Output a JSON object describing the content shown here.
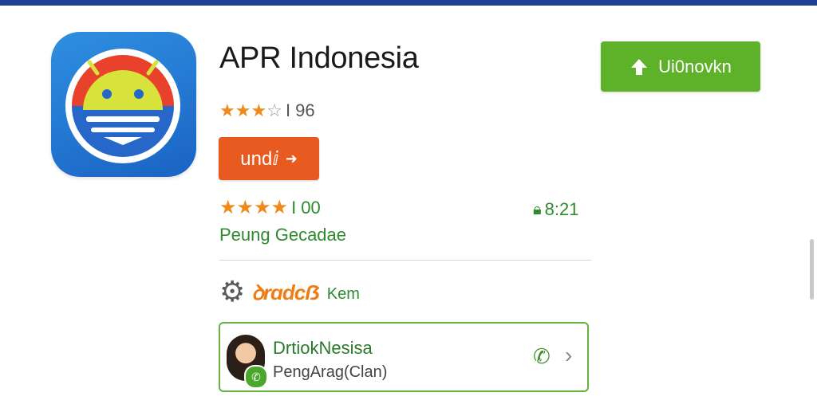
{
  "app": {
    "title": "APR Indonesia",
    "icon": "android-robot-icon"
  },
  "rating_primary": {
    "stars_filled": 3,
    "stars_total": 4,
    "text": "I 96"
  },
  "install_button": {
    "label": "undⅈ",
    "icon": "arrow-right-icon"
  },
  "download_button": {
    "label": "Ui0novkn",
    "icon": "upload-arrow-icon"
  },
  "rating_secondary": {
    "stars_filled": 4,
    "text": "I 00"
  },
  "time_info": {
    "icon": "lock-icon",
    "value": "8:21"
  },
  "subtitle_link": "Peung Gecadae",
  "settings_row": {
    "icon": "gear-icon",
    "label": "ꝺrɑdcẞ",
    "suffix": "Kem"
  },
  "contact_card": {
    "name": "DrtiokNesisa",
    "subtitle": "PengArag(Clan)",
    "actions": [
      "phone-icon",
      "chevron-right-icon"
    ]
  },
  "colors": {
    "top_bar": "#1e3f95",
    "download_green": "#5eb22a",
    "install_orange": "#e85a1f",
    "star_orange": "#f08a1c",
    "text_green": "#2e8b2e"
  }
}
